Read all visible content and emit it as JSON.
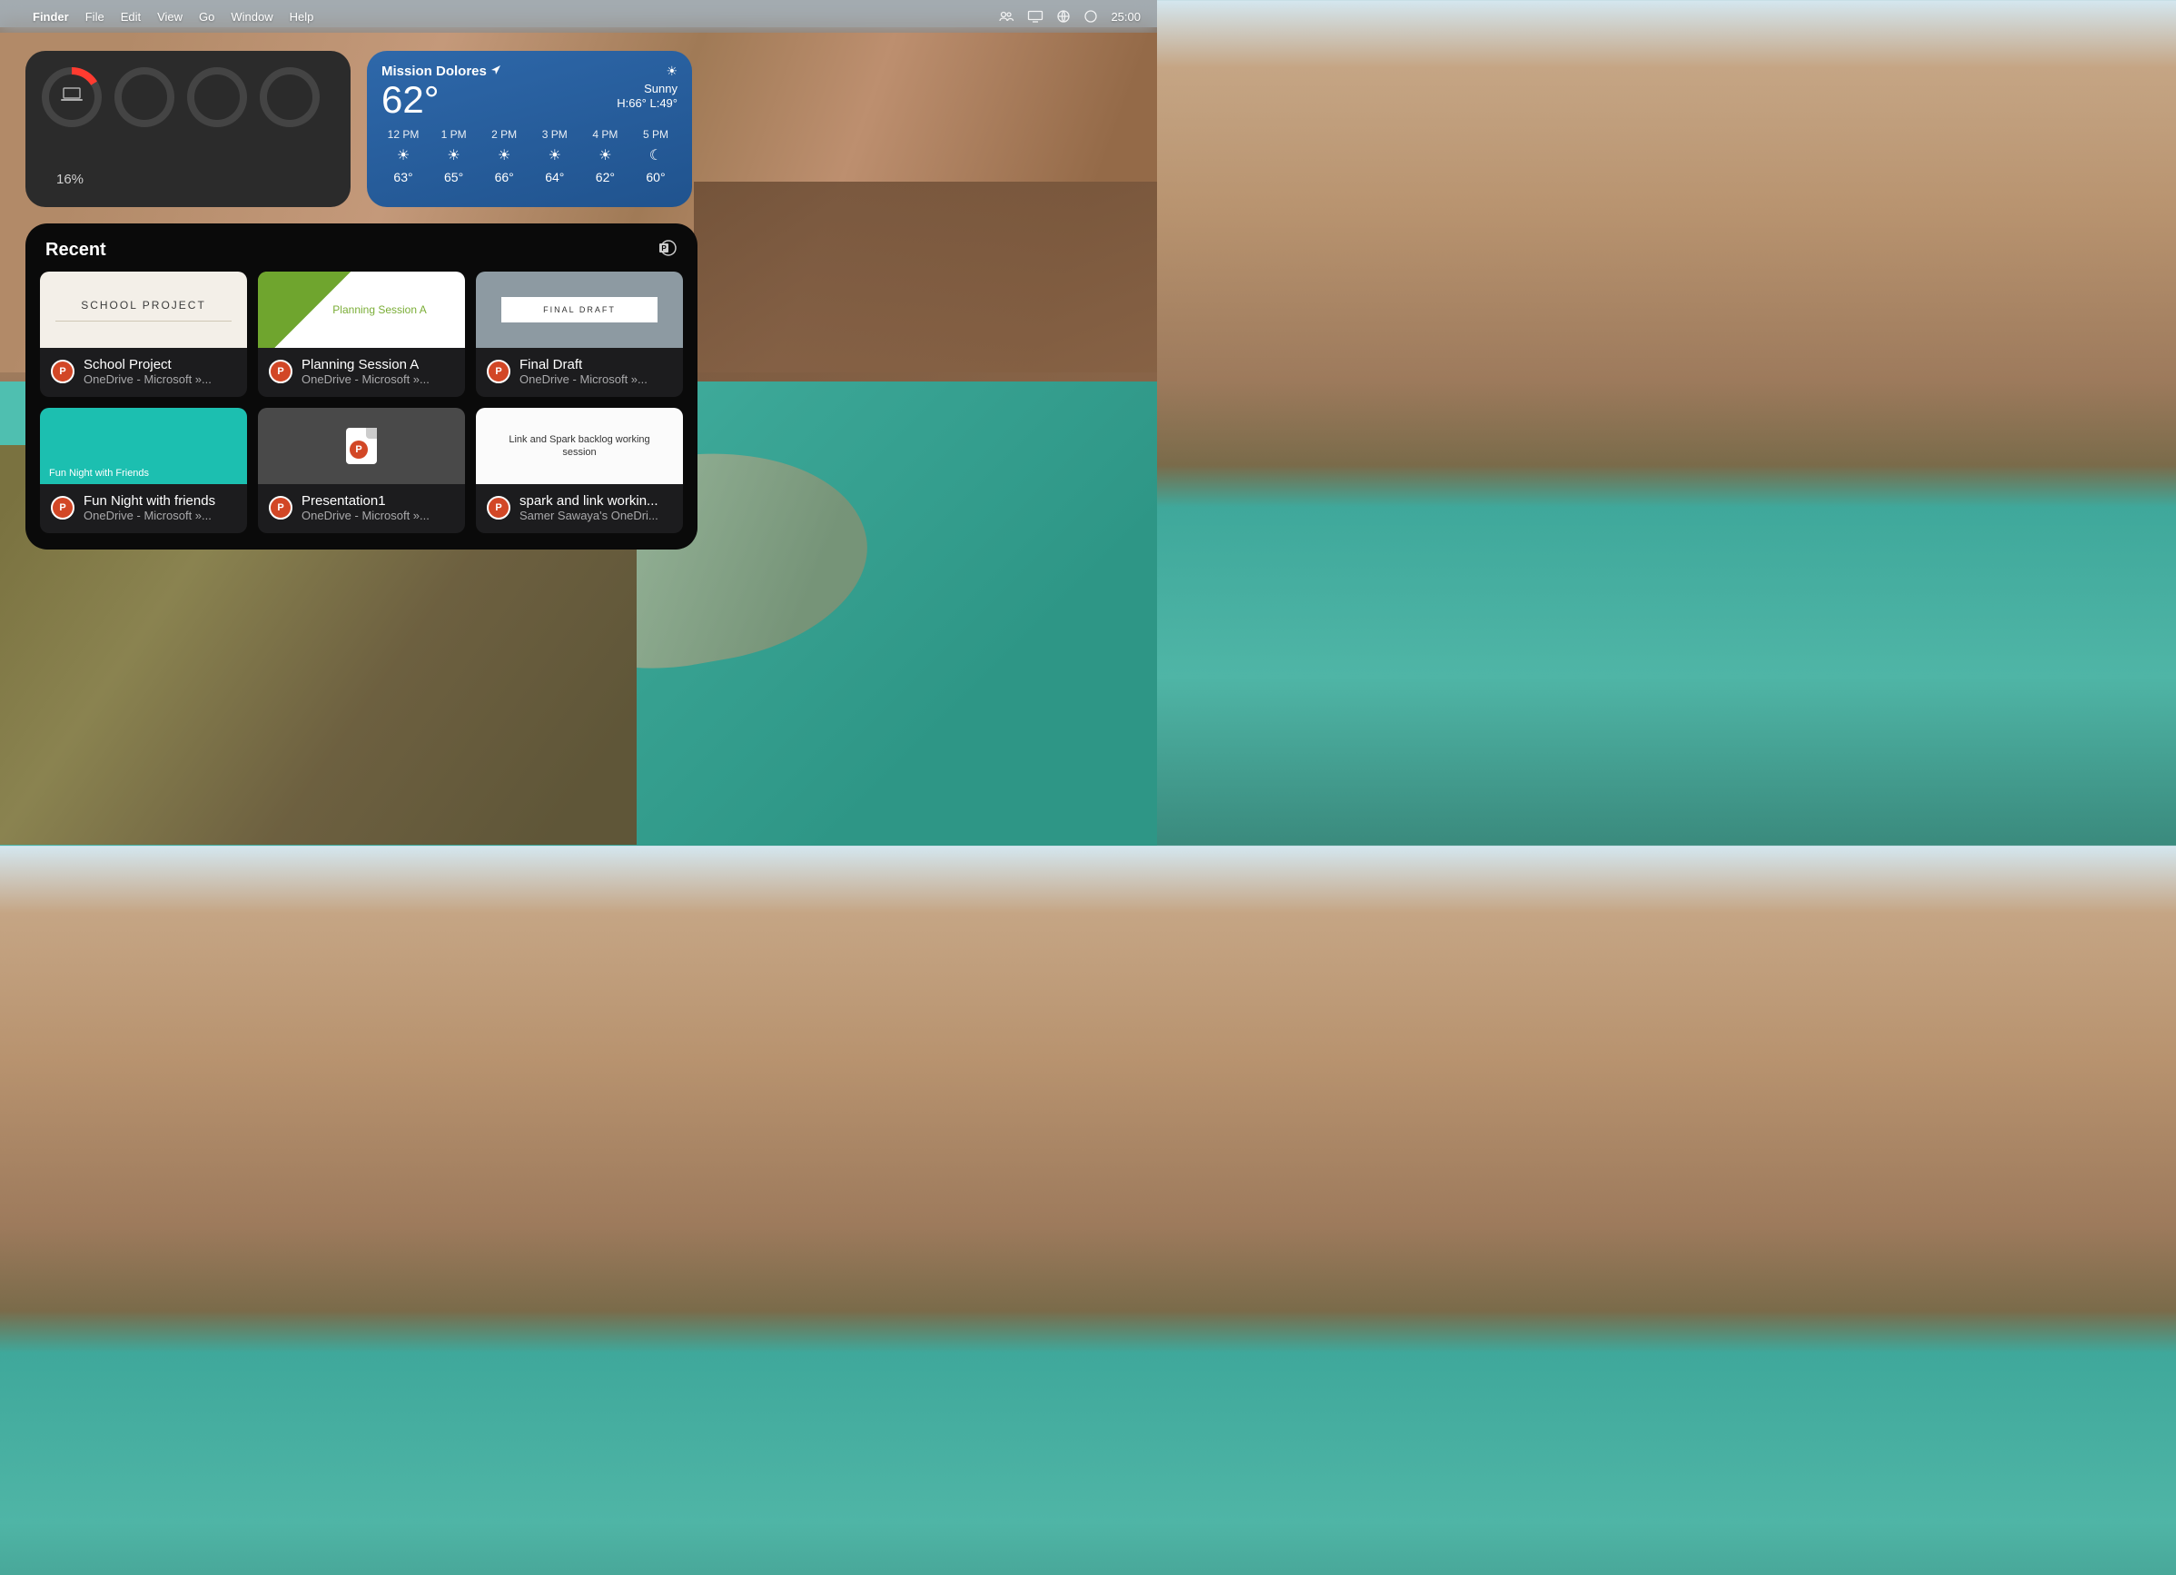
{
  "menubar": {
    "app": "Finder",
    "items": [
      "File",
      "Edit",
      "View",
      "Go",
      "Window",
      "Help"
    ],
    "clock": "25:00"
  },
  "battery": {
    "percent_label": "16%",
    "device_glyph": "laptop"
  },
  "weather": {
    "location": "Mission Dolores",
    "current_temp": "62°",
    "condition": "Sunny",
    "high_low": "H:66° L:49°",
    "forecast": [
      {
        "time": "12 PM",
        "icon": "sunny",
        "temp": "63°"
      },
      {
        "time": "1 PM",
        "icon": "sunny",
        "temp": "65°"
      },
      {
        "time": "2 PM",
        "icon": "sunny",
        "temp": "66°"
      },
      {
        "time": "3 PM",
        "icon": "sunny",
        "temp": "64°"
      },
      {
        "time": "4 PM",
        "icon": "sunny",
        "temp": "62°"
      },
      {
        "time": "5 PM",
        "icon": "clear-night",
        "temp": "60°"
      }
    ]
  },
  "recent": {
    "title": "Recent",
    "items": [
      {
        "name": "School Project",
        "location": "OneDrive - Microsoft »...",
        "thumb_title": "SCHOOL PROJECT"
      },
      {
        "name": "Planning Session A",
        "location": "OneDrive - Microsoft »...",
        "thumb_title": "Planning Session A"
      },
      {
        "name": "Final Draft",
        "location": "OneDrive - Microsoft »...",
        "thumb_title": "FINAL DRAFT"
      },
      {
        "name": "Fun Night with friends",
        "location": "OneDrive - Microsoft »...",
        "thumb_title": "Fun Night with Friends"
      },
      {
        "name": "Presentation1",
        "location": "OneDrive - Microsoft »...",
        "thumb_title": ""
      },
      {
        "name": "spark and link workin...",
        "location": "Samer Sawaya's OneDri...",
        "thumb_title": "Link and Spark backlog working session"
      }
    ]
  }
}
